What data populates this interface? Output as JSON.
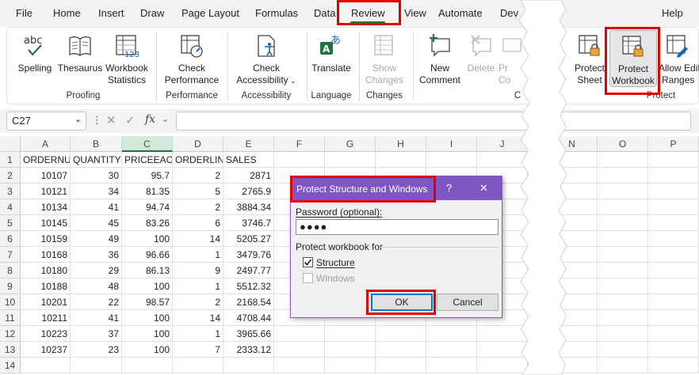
{
  "menu": {
    "tabs": [
      "File",
      "Home",
      "Insert",
      "Draw",
      "Page Layout",
      "Formulas",
      "Data",
      "Review",
      "View",
      "Automate",
      "Dev",
      "Help"
    ],
    "active_tab": "Review"
  },
  "ribbon": {
    "proofing": {
      "spelling": "Spelling",
      "spelling_icon_text": "abc",
      "thesaurus": "Thesaurus",
      "workbook_stats_1": "Workbook",
      "workbook_stats_2": "Statistics",
      "label": "Proofing"
    },
    "performance": {
      "check_1": "Check",
      "check_2": "Performance",
      "label": "Performance"
    },
    "accessibility": {
      "check_1": "Check",
      "check_2": "Accessibility",
      "label": "Accessibility"
    },
    "language": {
      "translate": "Translate",
      "label": "Language"
    },
    "changes": {
      "show_1": "Show",
      "show_2": "Changes",
      "label": "Changes"
    },
    "comments": {
      "new_1": "New",
      "new_2": "Comment",
      "delete": "Delete",
      "pr_1": "Pr",
      "pr_2": "Co",
      "label": "C"
    },
    "protect": {
      "sheet_1": "Protect",
      "sheet_2": "Sheet",
      "workbook_1": "Protect",
      "workbook_2": "Workbook",
      "allow_1": "Allow Edit",
      "allow_2": "Ranges",
      "label": "Protect"
    }
  },
  "formula_bar": {
    "name_box": "C27",
    "fx": "fx"
  },
  "grid": {
    "columns": [
      "A",
      "B",
      "C",
      "D",
      "E",
      "F",
      "G",
      "H",
      "I",
      "J",
      "N",
      "O",
      "P"
    ],
    "selected_column": "C",
    "row_numbers": [
      "1",
      "2",
      "3",
      "4",
      "5",
      "6",
      "7",
      "8",
      "9",
      "10",
      "11",
      "12",
      "13",
      "14"
    ],
    "headers": [
      "ORDERNU",
      "QUANTITY",
      "PRICEEACH",
      "ORDERLIN",
      "SALES"
    ],
    "rows": [
      [
        "10107",
        "30",
        "95.7",
        "2",
        "2871"
      ],
      [
        "10121",
        "34",
        "81.35",
        "5",
        "2765.9"
      ],
      [
        "10134",
        "41",
        "94.74",
        "2",
        "3884.34"
      ],
      [
        "10145",
        "45",
        "83.26",
        "6",
        "3746.7"
      ],
      [
        "10159",
        "49",
        "100",
        "14",
        "5205.27"
      ],
      [
        "10168",
        "36",
        "96.66",
        "1",
        "3479.76"
      ],
      [
        "10180",
        "29",
        "86.13",
        "9",
        "2497.77"
      ],
      [
        "10188",
        "48",
        "100",
        "1",
        "5512.32"
      ],
      [
        "10201",
        "22",
        "98.57",
        "2",
        "2168.54"
      ],
      [
        "10211",
        "41",
        "100",
        "14",
        "4708.44"
      ],
      [
        "10223",
        "37",
        "100",
        "1",
        "3965.66"
      ],
      [
        "10237",
        "23",
        "100",
        "7",
        "2333.12"
      ]
    ]
  },
  "dialog": {
    "title": "Protect Structure and Windows",
    "help": "?",
    "close": "✕",
    "password_label": "Password (optional):",
    "password_value": "●●●●",
    "section_label": "Protect workbook for",
    "structure_label": "Structure",
    "structure_checked": true,
    "windows_label": "Windows",
    "windows_checked": false,
    "ok": "OK",
    "cancel": "Cancel"
  },
  "colors": {
    "accent": "#1f7244",
    "dialog_title": "#7f56c3",
    "highlight": "#e00000"
  }
}
